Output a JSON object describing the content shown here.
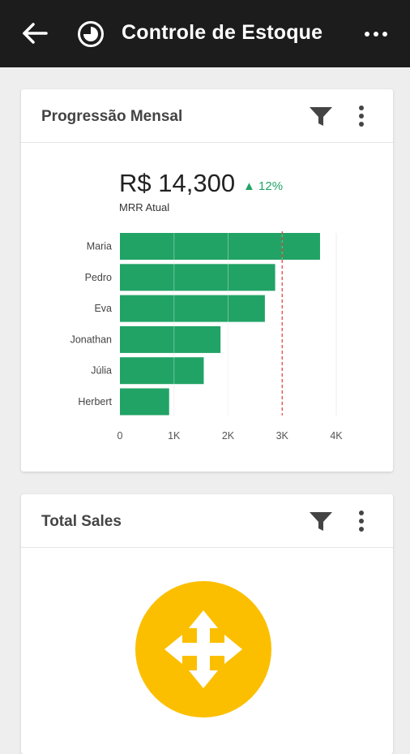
{
  "app": {
    "title": "Controle de Estoque",
    "back_icon": "arrow-left-icon",
    "logo_icon": "moon-clock-icon",
    "more_icon": "more-horizontal-icon"
  },
  "cards": [
    {
      "title": "Progressão Mensal",
      "filter_icon": "filter-icon",
      "menu_icon": "more-vertical-icon",
      "kpi": {
        "value": "R$ 14,300",
        "delta": "▲ 12%",
        "label": "MRR Atual"
      }
    },
    {
      "title": "Total Sales",
      "filter_icon": "filter-icon",
      "menu_icon": "more-vertical-icon",
      "action_icon": "move-arrows-icon"
    }
  ],
  "chart_data": {
    "type": "bar",
    "orientation": "horizontal",
    "categories": [
      "Maria",
      "Pedro",
      "Eva",
      "Jonathan",
      "Júlia",
      "Herbert"
    ],
    "values": [
      3700,
      2870,
      2680,
      1860,
      1550,
      910
    ],
    "xlim": [
      0,
      4000
    ],
    "xticks": [
      0,
      1000,
      2000,
      3000,
      4000
    ],
    "xtick_labels": [
      "0",
      "1K",
      "2K",
      "3K",
      "4K"
    ],
    "reference_line": 3000,
    "grid": true,
    "bar_color": "#21a366",
    "reference_color": "#e53935"
  },
  "colors": {
    "appbar": "#1c1c1c",
    "accent_green": "#21a366",
    "fab_yellow": "#fbbf00"
  }
}
